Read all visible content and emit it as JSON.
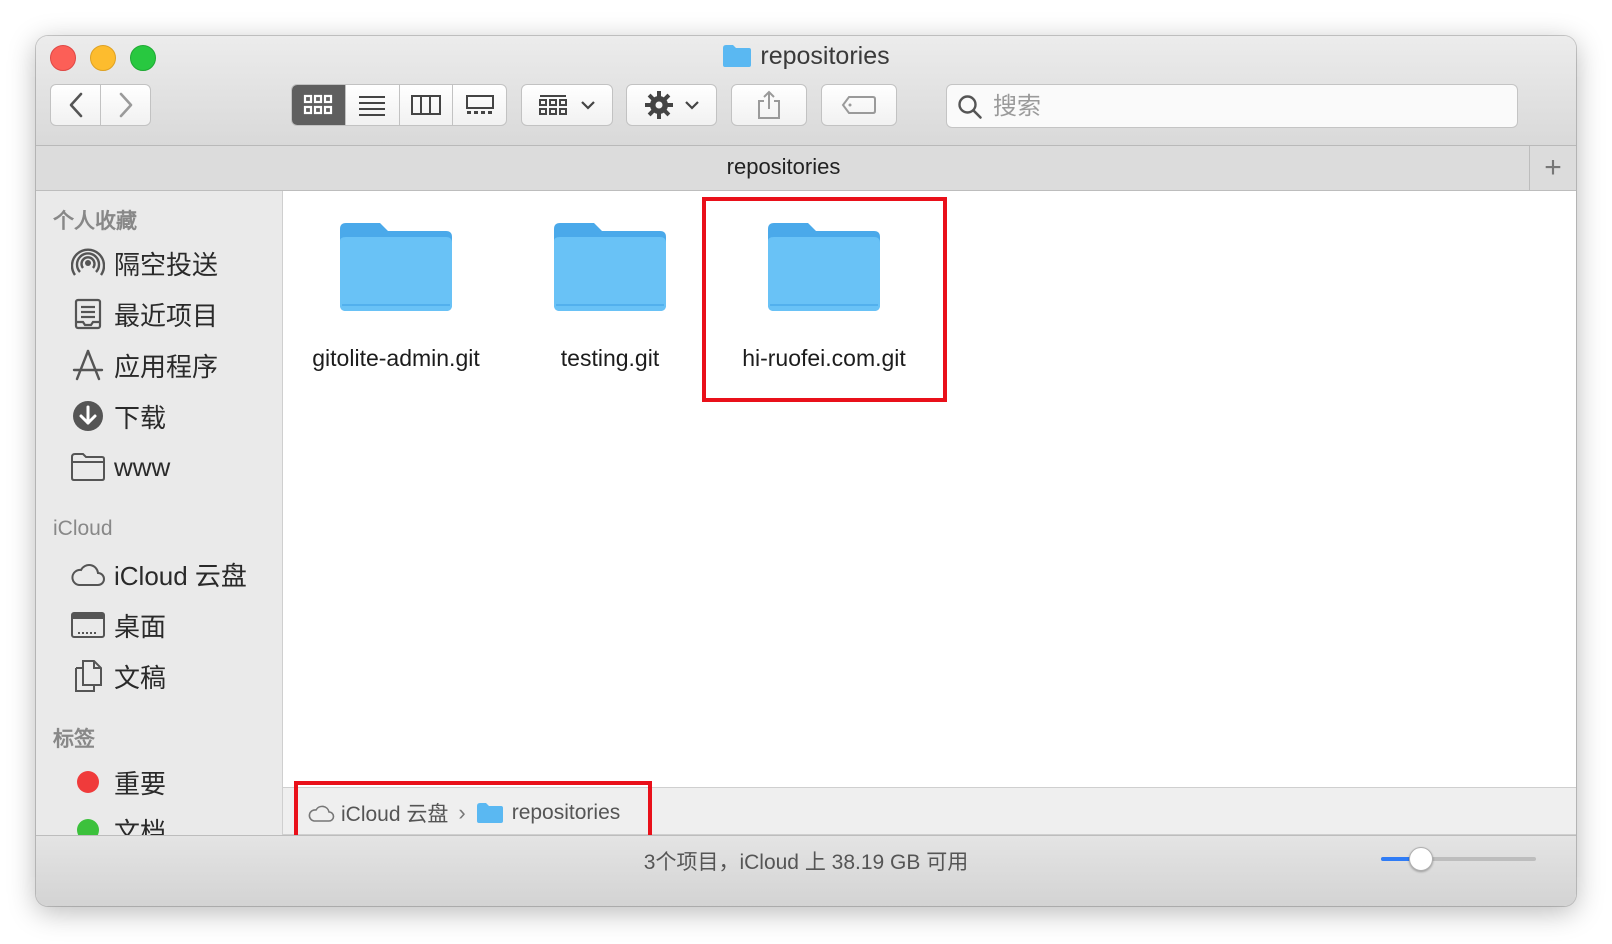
{
  "window": {
    "title": "repositories",
    "search_placeholder": "搜索"
  },
  "toolbar": {
    "back_icon": "chevron-left-icon",
    "forward_icon": "chevron-right-icon",
    "view_modes": [
      "icon-view",
      "list-view",
      "column-view",
      "gallery-view"
    ],
    "active_view": "icon-view",
    "group_icon": "group-by-icon",
    "action_icon": "gear-icon",
    "share_icon": "share-icon",
    "tag_icon": "tag-icon"
  },
  "tab": {
    "title": "repositories",
    "add_label": "+"
  },
  "sidebar": {
    "favorites_header": "个人收藏",
    "favorites": [
      {
        "label": "隔空投送",
        "icon": "airdrop-icon"
      },
      {
        "label": "最近项目",
        "icon": "recents-icon"
      },
      {
        "label": "应用程序",
        "icon": "applications-icon"
      },
      {
        "label": "下载",
        "icon": "download-icon"
      },
      {
        "label": "www",
        "icon": "folder-icon"
      }
    ],
    "icloud_header": "iCloud",
    "icloud": [
      {
        "label": "iCloud 云盘",
        "icon": "cloud-icon"
      },
      {
        "label": "桌面",
        "icon": "desktop-icon"
      },
      {
        "label": "文稿",
        "icon": "documents-icon"
      }
    ],
    "tags_header": "标签",
    "tags": [
      {
        "label": "重要",
        "color": "#f03b3b"
      },
      {
        "label": "文档",
        "color": "#3cc13c"
      }
    ]
  },
  "files": [
    {
      "name": "gitolite-admin.git",
      "highlighted": false
    },
    {
      "name": "testing.git",
      "highlighted": false
    },
    {
      "name": "hi-ruofei.com.git",
      "highlighted": true
    }
  ],
  "breadcrumb": {
    "items": [
      "iCloud 云盘",
      "repositories"
    ],
    "separator": "›"
  },
  "status": {
    "text": "3个项目，iCloud 上 38.19 GB 可用",
    "icon_size_level": 0.25
  },
  "colors": {
    "highlight": "#e9101a",
    "folder": "#5ab8f2",
    "accent": "#2f7cf6"
  }
}
